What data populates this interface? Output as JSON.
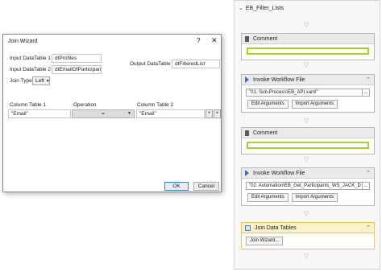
{
  "sequence": {
    "title": "EB_Filter_Lists"
  },
  "activities": {
    "comment1": {
      "title": "Comment"
    },
    "invoke1": {
      "title": "Invoke Workflow File",
      "path": "\"01. Sub-Process\\EB_API.xaml\"",
      "dots": "...",
      "edit_args": "Edit Arguments",
      "import_args": "Import Arguments"
    },
    "comment2": {
      "title": "Comment"
    },
    "invoke2": {
      "title": "Invoke Workflow File",
      "path": "\"02. Automation\\EB_Get_Participants_WS_JACK_D",
      "dots": "...",
      "edit_args": "Edit Arguments",
      "import_args": "Import Arguments"
    },
    "join": {
      "title": "Join Data Tables",
      "wizard_btn": "Join Wizard..."
    }
  },
  "dialog": {
    "title": "Join Wizard",
    "help": "?",
    "close": "✕",
    "input1_label": "Input DataTable 1",
    "input1_value": "dtProfiles",
    "input2_label": "Input DataTable 2",
    "input2_value": "dtEmailOfParticipant",
    "join_type_label": "Join Type",
    "join_type_value": "Left",
    "output_label": "Output DataTable",
    "output_value": "dtFilteredList",
    "col1_header": "Column Table 1",
    "op_header": "Operation",
    "col2_header": "Column Table 2",
    "row": {
      "col1": "\"Email\"",
      "op": "=",
      "col2": "\"Email\""
    },
    "add_btn": "+",
    "remove_btn": "×",
    "ok": "OK",
    "cancel": "Cancel"
  }
}
